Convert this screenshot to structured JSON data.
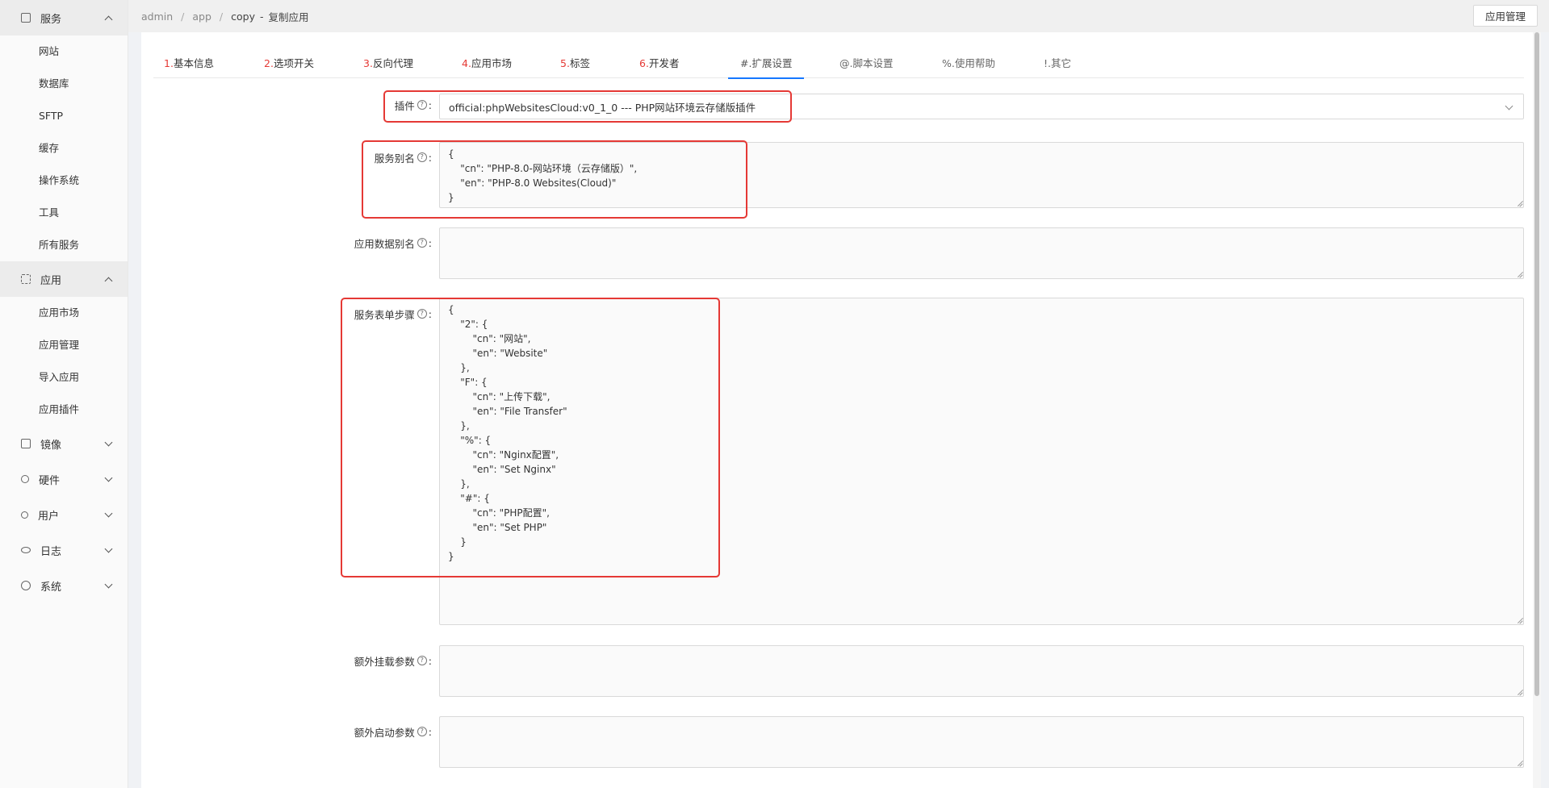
{
  "sidebar": {
    "groups": [
      {
        "label": "服务",
        "icon": "store-icon",
        "expanded": true,
        "items": [
          "网站",
          "数据库",
          "SFTP",
          "缓存",
          "操作系统",
          "工具",
          "所有服务"
        ]
      },
      {
        "label": "应用",
        "icon": "apps-icon",
        "expanded": true,
        "items": [
          "应用市场",
          "应用管理",
          "导入应用",
          "应用插件"
        ]
      },
      {
        "label": "镜像",
        "icon": "image-icon",
        "expanded": false,
        "items": []
      },
      {
        "label": "硬件",
        "icon": "share-icon",
        "expanded": false,
        "items": []
      },
      {
        "label": "用户",
        "icon": "user-icon",
        "expanded": false,
        "items": []
      },
      {
        "label": "日志",
        "icon": "eye-icon",
        "expanded": false,
        "items": []
      },
      {
        "label": "系统",
        "icon": "settings-icon",
        "expanded": false,
        "items": []
      }
    ]
  },
  "breadcrumb": {
    "items": [
      "admin",
      "app",
      "copy"
    ],
    "current": "复制应用",
    "separator": "/",
    "dash": "-"
  },
  "header": {
    "action_button": "应用管理"
  },
  "tabs": [
    {
      "num": "1.",
      "label": "基本信息"
    },
    {
      "num": "2.",
      "label": "选项开关"
    },
    {
      "num": "3.",
      "label": "反向代理"
    },
    {
      "num": "4.",
      "label": "应用市场"
    },
    {
      "num": "5.",
      "label": "标签"
    },
    {
      "num": "6.",
      "label": "开发者"
    },
    {
      "num": "#.",
      "label": "扩展设置",
      "active": true
    },
    {
      "num": "@.",
      "label": "脚本设置"
    },
    {
      "num": "%.",
      "label": "使用帮助"
    },
    {
      "num": "!.",
      "label": "其它"
    }
  ],
  "form": {
    "plugin": {
      "label": "插件",
      "value": "official:phpWebsitesCloud:v0_1_0 --- PHP网站环境云存储版插件"
    },
    "service_alias": {
      "label": "服务别名",
      "value": "{\n    \"cn\": \"PHP-8.0-网站环境（云存储版）\",\n    \"en\": \"PHP-8.0 Websites(Cloud)\"\n}"
    },
    "app_data_alias": {
      "label": "应用数据别名",
      "value": ""
    },
    "form_steps": {
      "label": "服务表单步骤",
      "value": "{\n    \"2\": {\n        \"cn\": \"网站\",\n        \"en\": \"Website\"\n    },\n    \"F\": {\n        \"cn\": \"上传下载\",\n        \"en\": \"File Transfer\"\n    },\n    \"%\": {\n        \"cn\": \"Nginx配置\",\n        \"en\": \"Set Nginx\"\n    },\n    \"#\": {\n        \"cn\": \"PHP配置\",\n        \"en\": \"Set PHP\"\n    }\n}"
    },
    "extra_mount": {
      "label": "额外挂载参数",
      "value": ""
    },
    "extra_start": {
      "label": "额外启动参数",
      "value": ""
    }
  },
  "colors": {
    "highlight": "#e53935",
    "active_tab": "#1677ff",
    "tab_number": "#e53935"
  }
}
